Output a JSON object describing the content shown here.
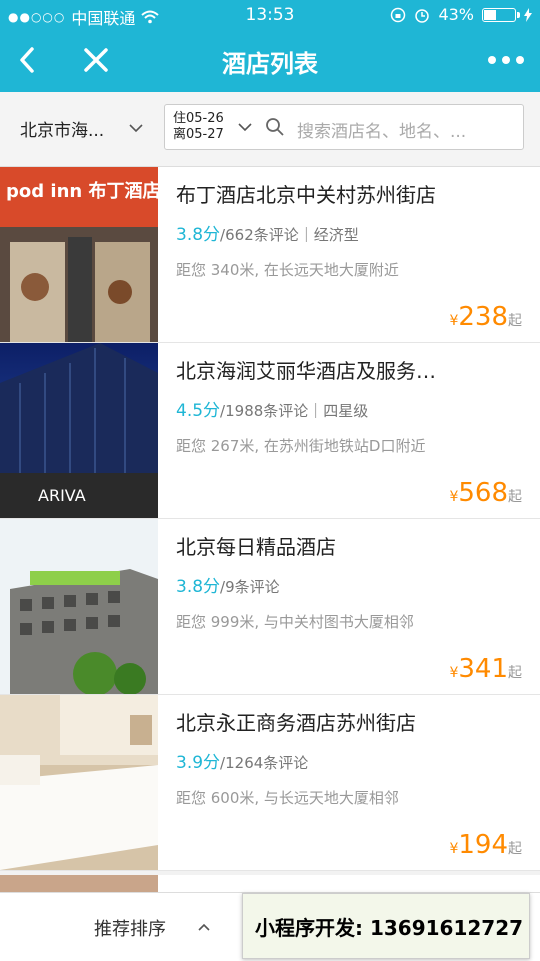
{
  "status_bar": {
    "carrier": "中国联通",
    "time": "13:53",
    "battery": "43%",
    "battery_level": 0.43
  },
  "nav": {
    "title": "酒店列表"
  },
  "filter": {
    "city": "北京市海...",
    "checkin": "住05-26",
    "checkout": "离05-27",
    "search_placeholder": "搜索酒店名、地名、..."
  },
  "hotels": [
    {
      "name": "布丁酒店北京中关村苏州街店",
      "score": "3.8分",
      "meta": "/662条评论｜经济型",
      "distance": "距您 340米, 在长远天地大厦附近",
      "currency": "¥",
      "price": "238",
      "suffix": "起"
    },
    {
      "name": "北京海润艾丽华酒店及服务…",
      "score": "4.5分",
      "meta": "/1988条评论｜四星级",
      "distance": "距您 267米, 在苏州街地铁站D口附近",
      "currency": "¥",
      "price": "568",
      "suffix": "起"
    },
    {
      "name": "北京每日精品酒店",
      "score": "3.8分",
      "meta": "/9条评论",
      "distance": "距您 999米, 与中关村图书大厦相邻",
      "currency": "¥",
      "price": "341",
      "suffix": "起"
    },
    {
      "name": "北京永正商务酒店苏州街店",
      "score": "3.9分",
      "meta": "/1264条评论",
      "distance": "距您 600米, 与长远天地大厦相邻",
      "currency": "¥",
      "price": "194",
      "suffix": "起"
    }
  ],
  "hotel_images": {
    "sign_text": "pod inn 布丁酒店",
    "building_text": "ARIVA"
  },
  "bottom": {
    "sort_label": "推荐排序",
    "promo": "小程序开发:  13691612727"
  },
  "colors": {
    "accent": "#1fb6d5",
    "price": "#ff8a00"
  }
}
